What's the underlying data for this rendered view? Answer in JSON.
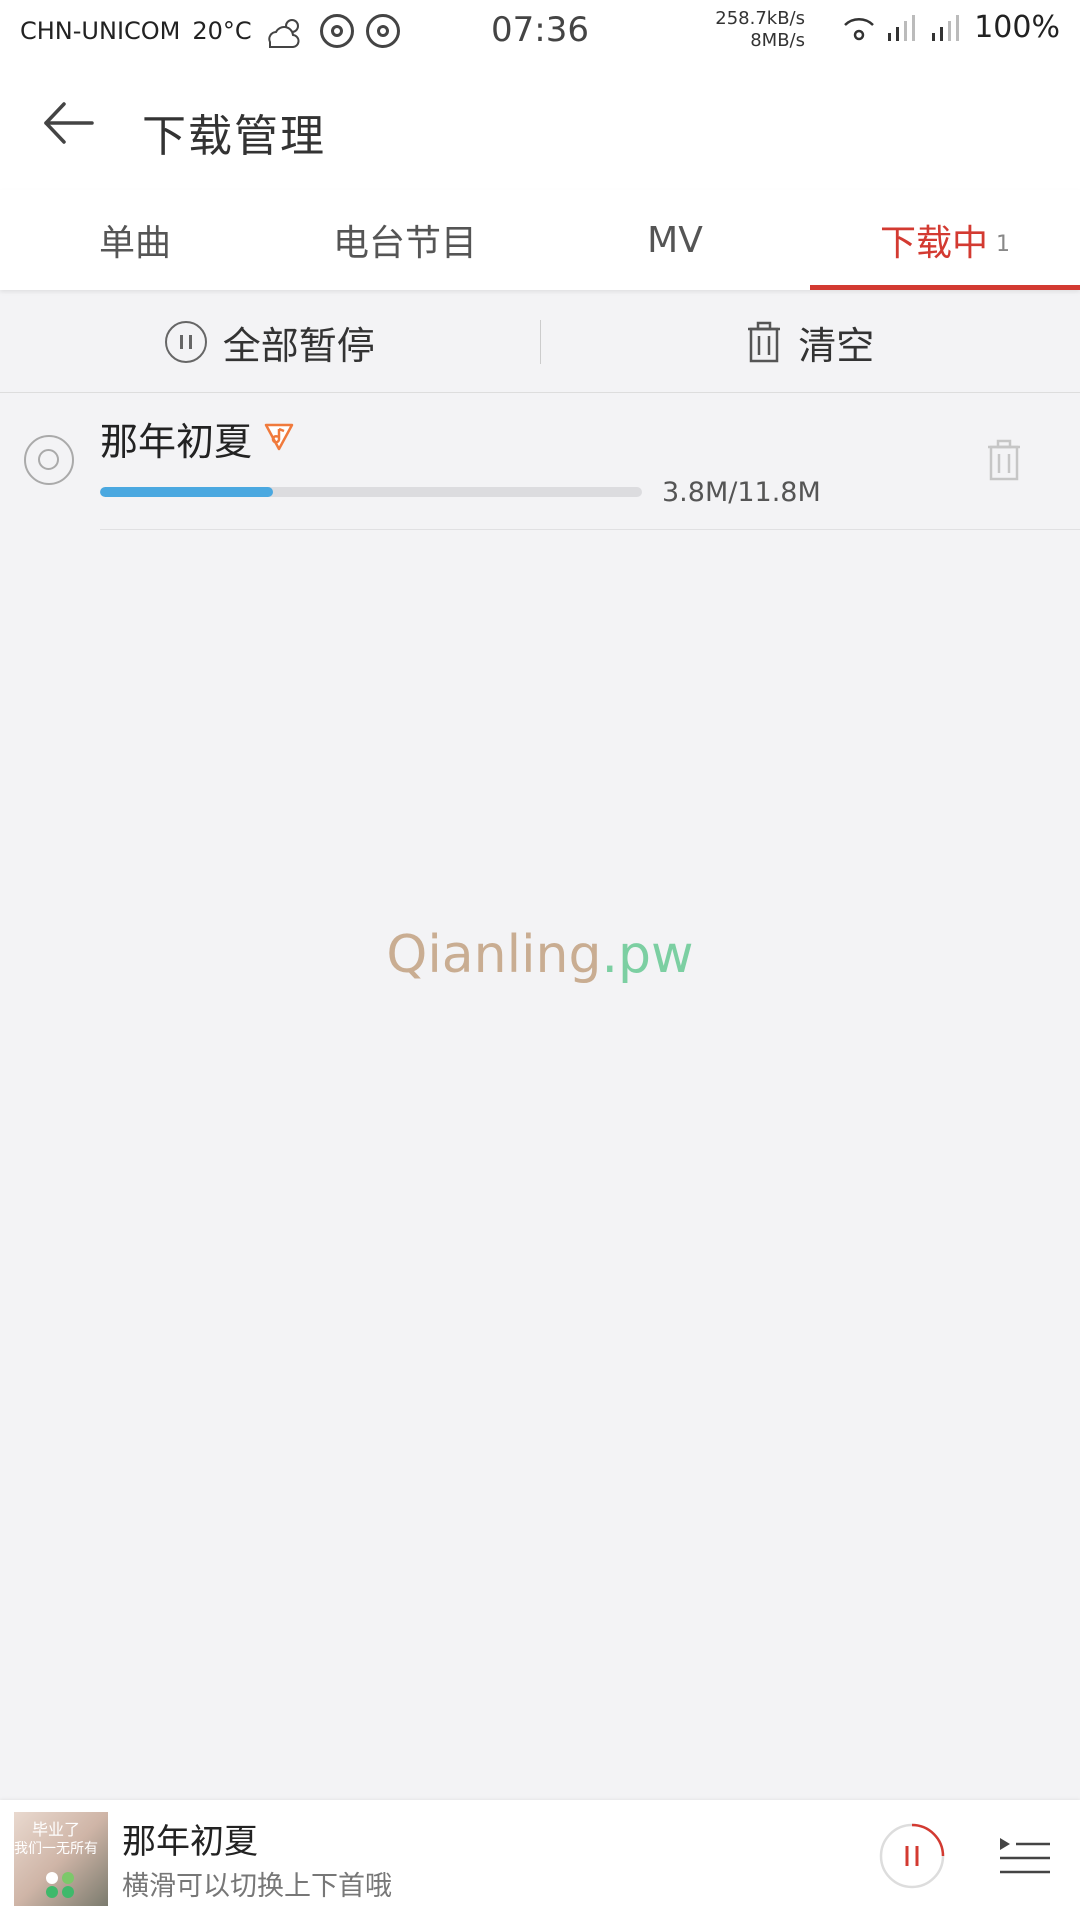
{
  "status_bar": {
    "carrier": "CHN-UNICOM",
    "temperature": "20°C",
    "time": "07:36",
    "speed_up": "258.7kB/s",
    "speed_down": "8MB/s",
    "battery": "100%"
  },
  "header": {
    "title": "下载管理"
  },
  "tabs": [
    {
      "label": "单曲"
    },
    {
      "label": "电台节目"
    },
    {
      "label": "MV"
    },
    {
      "label": "下载中",
      "count": "1"
    }
  ],
  "actions": {
    "pause_all": "全部暂停",
    "clear": "清空"
  },
  "download": {
    "song": "那年初夏",
    "size": "3.8M/11.8M",
    "progress": 0.32
  },
  "watermark": {
    "main": "Qianling",
    "suffix": ".pw"
  },
  "player": {
    "title": "那年初夏",
    "hint": "横滑可以切换上下首哦"
  },
  "colors": {
    "accent": "#d33a31",
    "progress": "#4aa8e0"
  }
}
